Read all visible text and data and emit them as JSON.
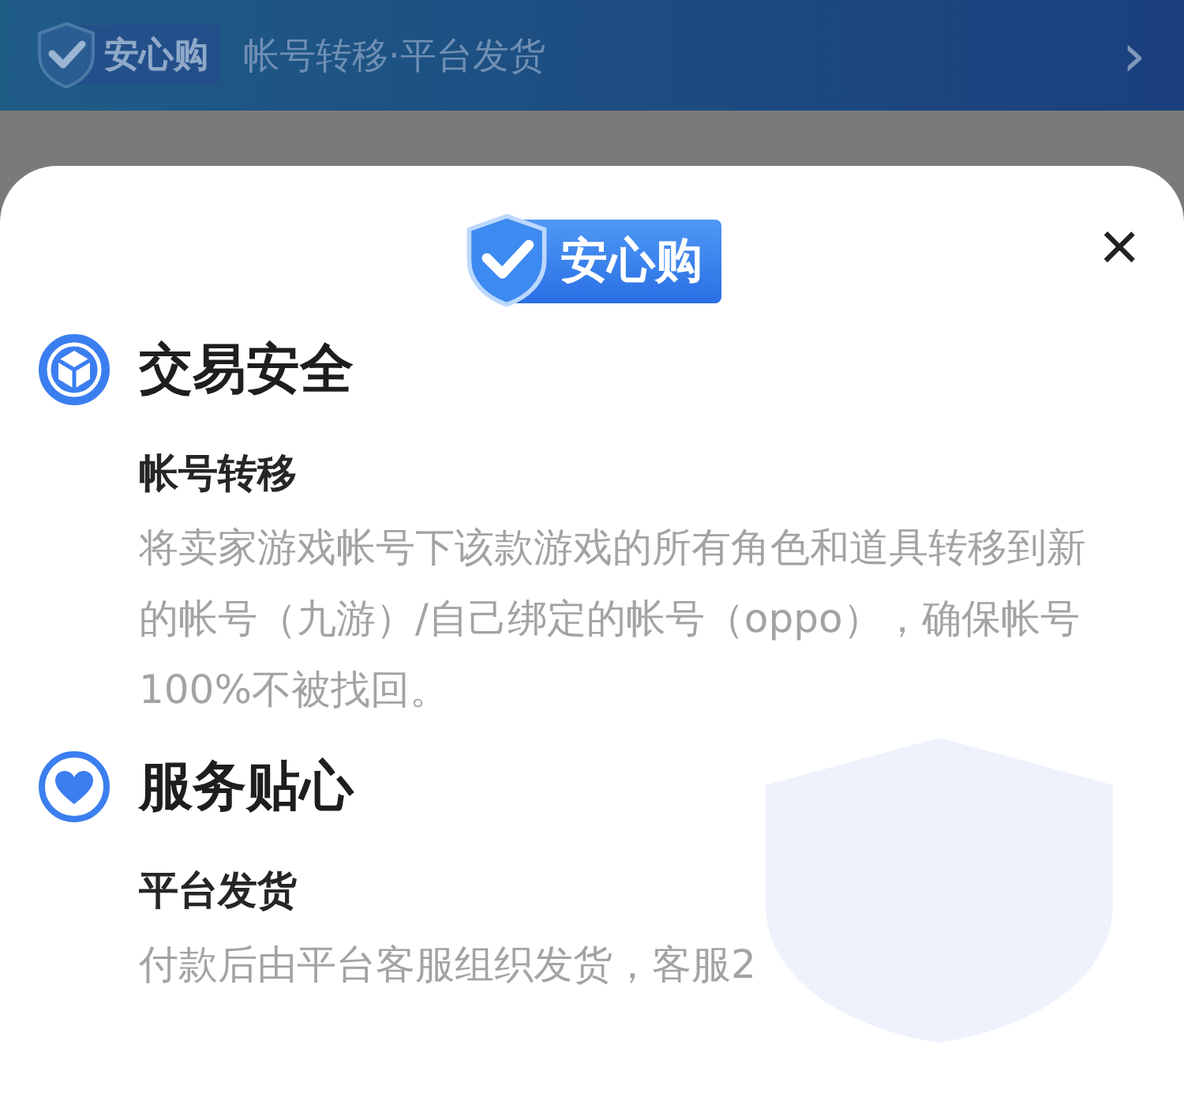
{
  "banner": {
    "logo": "安心购",
    "text": "帐号转移·平台发货",
    "chevron": "›"
  },
  "sheet": {
    "logo": "安心购",
    "close": "×",
    "sections": [
      {
        "kind": "cube",
        "title": "交易安全",
        "subtitle": "帐号转移",
        "body": "将卖家游戏帐号下该款游戏的所有角色和道具转移到新的帐号（九游）/自己绑定的帐号（oppo），确保帐号100%不被找回。"
      },
      {
        "kind": "heart",
        "title": "服务贴心",
        "subtitle": "平台发货",
        "body": "付款后由平台客服组织发货，客服2"
      }
    ]
  }
}
